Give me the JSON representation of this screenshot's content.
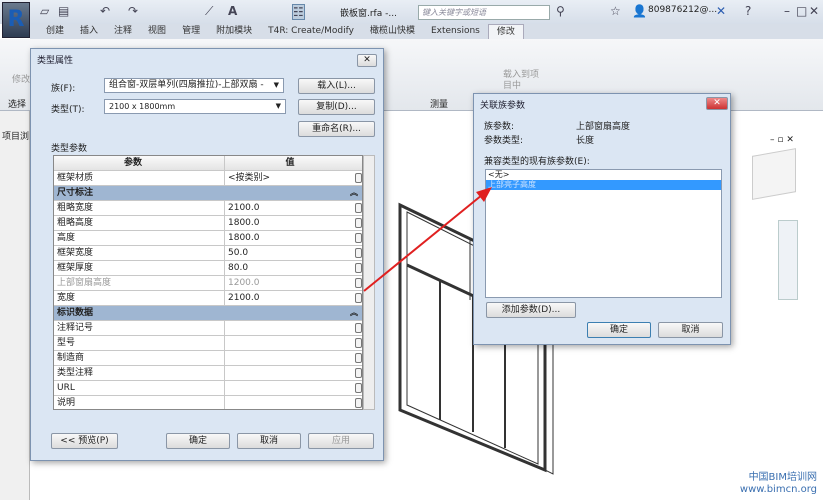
{
  "app": {
    "doc_title": "嵌板窗.rfa -...",
    "search_placeholder": "键入关键字或短语",
    "user": "809876212@...",
    "tabs": [
      "创建",
      "插入",
      "注释",
      "视图",
      "管理",
      "附加模块",
      "T4R: Create/Modify",
      "橄榄山快模",
      "Extensions",
      "修改"
    ],
    "active_tab": "修改",
    "ribbon_labels": {
      "modify": "修改",
      "select": "选择",
      "measure": "测量",
      "load_to_project": "载入到项目中"
    },
    "project_browser": "项目浏"
  },
  "type_properties": {
    "title": "类型属性",
    "family_label": "族(F):",
    "family_value": "组合窗-双层单列(四扇推拉)-上部双扇 -",
    "type_label": "类型(T):",
    "type_value": "2100 x 1800mm",
    "load_button": "载入(L)...",
    "duplicate_button": "复制(D)...",
    "rename_button": "重命名(R)...",
    "section_label": "类型参数",
    "columns": [
      "参数",
      "值"
    ],
    "rows": [
      {
        "name": "框架材质",
        "value": "<按类别>"
      },
      {
        "group": "尺寸标注"
      },
      {
        "name": "粗略宽度",
        "value": "2100.0"
      },
      {
        "name": "粗略高度",
        "value": "1800.0"
      },
      {
        "name": "高度",
        "value": "1800.0"
      },
      {
        "name": "框架宽度",
        "value": "50.0"
      },
      {
        "name": "框架厚度",
        "value": "80.0"
      },
      {
        "name": "上部窗扇高度",
        "value": "1200.0",
        "disabled": true
      },
      {
        "name": "宽度",
        "value": "2100.0"
      },
      {
        "group": "标识数据"
      },
      {
        "name": "注释记号",
        "value": ""
      },
      {
        "name": "型号",
        "value": ""
      },
      {
        "name": "制造商",
        "value": ""
      },
      {
        "name": "类型注释",
        "value": ""
      },
      {
        "name": "URL",
        "value": ""
      },
      {
        "name": "说明",
        "value": ""
      }
    ],
    "preview_button": "<< 预览(P)",
    "ok_button": "确定",
    "cancel_button": "取消",
    "apply_button": "应用"
  },
  "associate_param": {
    "title": "关联族参数",
    "family_param_label": "族参数:",
    "family_param_value": "上部窗扇高度",
    "param_type_label": "参数类型:",
    "param_type_value": "长度",
    "list_label": "兼容类型的现有族参数(E):",
    "list_items": [
      "<无>",
      "上部亮子高度"
    ],
    "selected_index": 1,
    "add_param_button": "添加参数(D)...",
    "ok_button": "确定",
    "cancel_button": "取消"
  },
  "watermark": {
    "line1": "中国BIM培训网",
    "line2": "www.bimcn.org"
  },
  "colors": {
    "selection": "#3399ff",
    "group_row": "#9fb6d2",
    "arrow": "#e02020",
    "dialog_bg": "#dbe6f3"
  }
}
